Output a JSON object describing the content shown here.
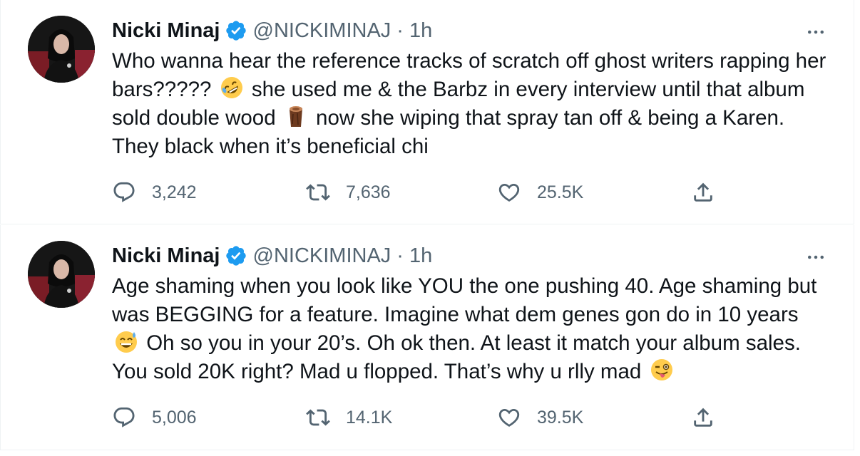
{
  "tweets": [
    {
      "author": {
        "name": "Nicki Minaj",
        "handle": "@NICKIMINAJ",
        "separator": "·",
        "time": "1h",
        "verified": true
      },
      "text_parts": [
        "Who wanna hear the reference tracks of scratch off ghost writers rapping her bars?????",
        "she used me & the Barbz in every interview until that album sold double wood",
        "now she wiping that spray tan off & being a Karen. They black when it’s beneficial chi"
      ],
      "emojis": [
        "rolling-on-floor-laughing-emoji",
        "wood-log-emoji"
      ],
      "stats": {
        "replies": "3,242",
        "retweets": "7,636",
        "likes": "25.5K"
      }
    },
    {
      "author": {
        "name": "Nicki Minaj",
        "handle": "@NICKIMINAJ",
        "separator": "·",
        "time": "1h",
        "verified": true
      },
      "text_parts": [
        "Age shaming when you look like YOU the one pushing 40. Age shaming but was BEGGING for a feature. Imagine what dem genes gon do in 10 years",
        "Oh so you in your 20’s. Oh ok then. At least it match your album sales. You sold 20K right? Mad u flopped. That’s why u rlly mad"
      ],
      "emojis": [
        "grinning-sweat-emoji",
        "winking-tongue-emoji"
      ],
      "stats": {
        "replies": "5,006",
        "retweets": "14.1K",
        "likes": "39.5K"
      }
    }
  ],
  "colors": {
    "text_primary": "#0f1419",
    "text_secondary": "#536471",
    "verified_blue": "#1d9bf0",
    "divider": "#eff3f4"
  },
  "icons": [
    "reply-icon",
    "retweet-icon",
    "like-icon",
    "share-icon",
    "more-icon",
    "verified-badge-icon"
  ]
}
